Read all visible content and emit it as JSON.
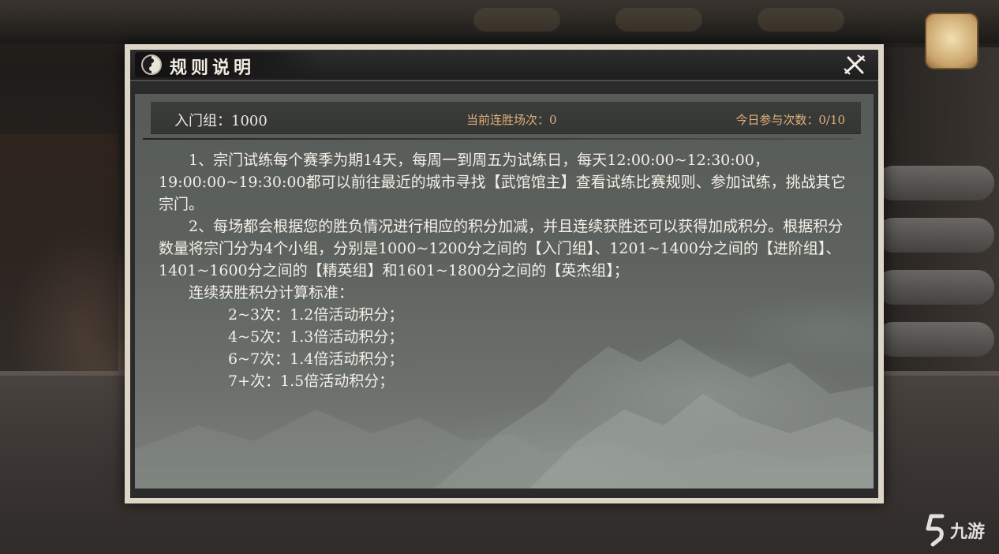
{
  "dialog": {
    "title": "规则说明"
  },
  "stats": {
    "group": "入门组：1000",
    "streak": "当前连胜场次：0",
    "daily": "今日参与次数：0/10"
  },
  "rules": {
    "para1": "1、宗门试练每个赛季为期14天，每周一到周五为试练日，每天12:00:00~12:30:00，19:00:00~19:30:00都可以前往最近的城市寻找【武馆馆主】查看试练比赛规则、参加试练，挑战其它宗门。",
    "para2": "2、每场都会根据您的胜负情况进行相应的积分加减，并且连续获胜还可以获得加成积分。根据积分数量将宗门分为4个小组，分别是1000~1200分之间的【入门组】、1201~1400分之间的【进阶组】、1401~1600分之间的【精英组】和1601~1800分之间的【英杰组】；",
    "bonus_heading": "连续获胜积分计算标准：",
    "bonus_tiers": [
      "2~3次：1.2倍活动积分；",
      "4~5次：1.3倍活动积分；",
      "6~7次：1.4倍活动积分；",
      "7+次：1.5倍活动积分；"
    ]
  },
  "watermark": {
    "text": "九游",
    "icon": "jiuyou-logo-icon"
  },
  "icons": {
    "title": "yin-yang-icon",
    "close": "crossed-swords-close-icon"
  },
  "colors": {
    "accent_orange": "#e2b07a",
    "text_light": "#f3efe6",
    "frame": "#ddd6c7"
  }
}
